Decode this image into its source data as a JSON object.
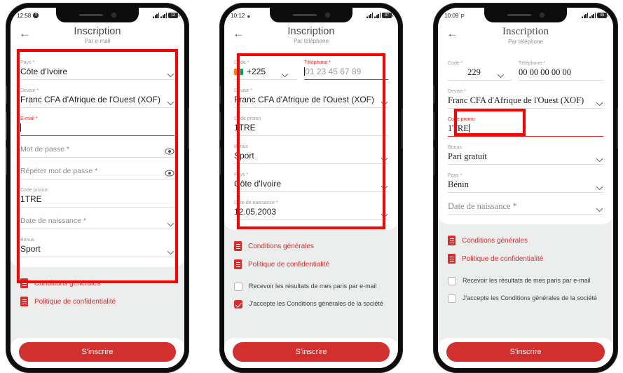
{
  "page": {
    "background": "#ffffff",
    "accent": "#e02a2a",
    "annotation_color": "#ff0000"
  },
  "phones": [
    {
      "id": "phone-1",
      "status": {
        "time": "12:58",
        "battery": "12"
      },
      "header": {
        "title": "Inscription",
        "subtitle": "Par e-mail",
        "back_icon": "back-arrow-icon"
      },
      "fields": [
        {
          "label": "Pays *",
          "value": "Côte d'Ivoire",
          "type": "select",
          "state": "normal"
        },
        {
          "label": "Devise *",
          "value": "Franc CFA d'Afrique de l'Ouest (XOF)",
          "type": "select",
          "state": "normal"
        },
        {
          "label": "E-mail *",
          "value": "",
          "type": "text",
          "state": "focused"
        },
        {
          "label": "Mot de passe *",
          "value": "",
          "type": "password",
          "state": "empty-label"
        },
        {
          "label": "Répéter mot de passe *",
          "value": "",
          "type": "password",
          "state": "empty-label"
        },
        {
          "label": "Code promo",
          "value": "1TRE",
          "type": "text",
          "state": "normal"
        },
        {
          "label": "Date de naissance *",
          "value": "",
          "type": "select",
          "state": "empty-label"
        },
        {
          "label": "Bonus",
          "value": "Sport",
          "type": "select",
          "state": "normal"
        }
      ],
      "links": [
        {
          "text": "Conditions générales",
          "icon": "document-icon"
        },
        {
          "text": "Politique de confidentialité",
          "icon": "document-icon"
        }
      ],
      "checkboxes": [],
      "submit": "S'inscrire"
    },
    {
      "id": "phone-2",
      "status": {
        "time": "10:12",
        "battery": "87"
      },
      "header": {
        "title": "Inscription",
        "subtitle": "Par téléphone",
        "back_icon": "back-arrow-icon"
      },
      "code_field": {
        "label": "Code *",
        "value": "+225",
        "flag": "cote-divoire-flag"
      },
      "tel_field": {
        "label": "Téléphone *",
        "placeholder": "01 23 45 67 89",
        "state": "focused"
      },
      "fields": [
        {
          "label": "Devise *",
          "value": "Franc CFA d'Afrique de l'Ouest (XOF)",
          "type": "select",
          "state": "normal"
        },
        {
          "label": "Code promo",
          "value": "1TRE",
          "type": "text",
          "state": "normal"
        },
        {
          "label": "Bonus",
          "value": "Sport",
          "type": "select",
          "state": "normal"
        },
        {
          "label": "Pays *",
          "value": "Côte d'Ivoire",
          "type": "select",
          "state": "normal"
        },
        {
          "label": "Date de naissance *",
          "value": "12.05.2003",
          "type": "select",
          "state": "normal"
        }
      ],
      "links": [
        {
          "text": "Conditions générales",
          "icon": "document-icon"
        },
        {
          "text": "Politique de confidentialité",
          "icon": "document-icon"
        }
      ],
      "checkboxes": [
        {
          "text": "Recevoir les résultats de mes paris par e-mail",
          "checked": false
        },
        {
          "text": "J'accepte les Conditions générales de la société",
          "checked": true
        }
      ],
      "submit": "S'inscrire"
    },
    {
      "id": "phone-3",
      "status": {
        "time": "10:09",
        "battery": "49"
      },
      "header": {
        "title": "Inscription",
        "subtitle": "Par téléphone",
        "back_icon": "back-arrow-icon"
      },
      "code_field": {
        "label": "Code *",
        "value": "229",
        "flag": ""
      },
      "tel_field": {
        "label": "Téléphone *",
        "placeholder": "00 00 00 00 00",
        "state": "normal"
      },
      "fields": [
        {
          "label": "Devise *",
          "value": "Franc CFA d'Afrique de l'Ouest (XOF)",
          "type": "select",
          "state": "normal"
        },
        {
          "label": "Code promo",
          "value": "1TRE",
          "type": "text",
          "state": "focused-value"
        },
        {
          "label": "Bonus",
          "value": "Pari gratuit",
          "type": "select",
          "state": "normal"
        },
        {
          "label": "Pays *",
          "value": "Bénin",
          "type": "select",
          "state": "normal"
        },
        {
          "label": "Date de naissance *",
          "value": "",
          "type": "select",
          "state": "empty-label"
        }
      ],
      "links": [
        {
          "text": "Conditions générales",
          "icon": "document-icon"
        },
        {
          "text": "Politique de confidentialité",
          "icon": "document-icon"
        }
      ],
      "checkboxes": [
        {
          "text": "Recevoir les résultats de mes paris par e-mail",
          "checked": false
        },
        {
          "text": "J'accepte les Conditions générales de la société",
          "checked": false
        }
      ],
      "submit": "S'inscrire"
    }
  ]
}
